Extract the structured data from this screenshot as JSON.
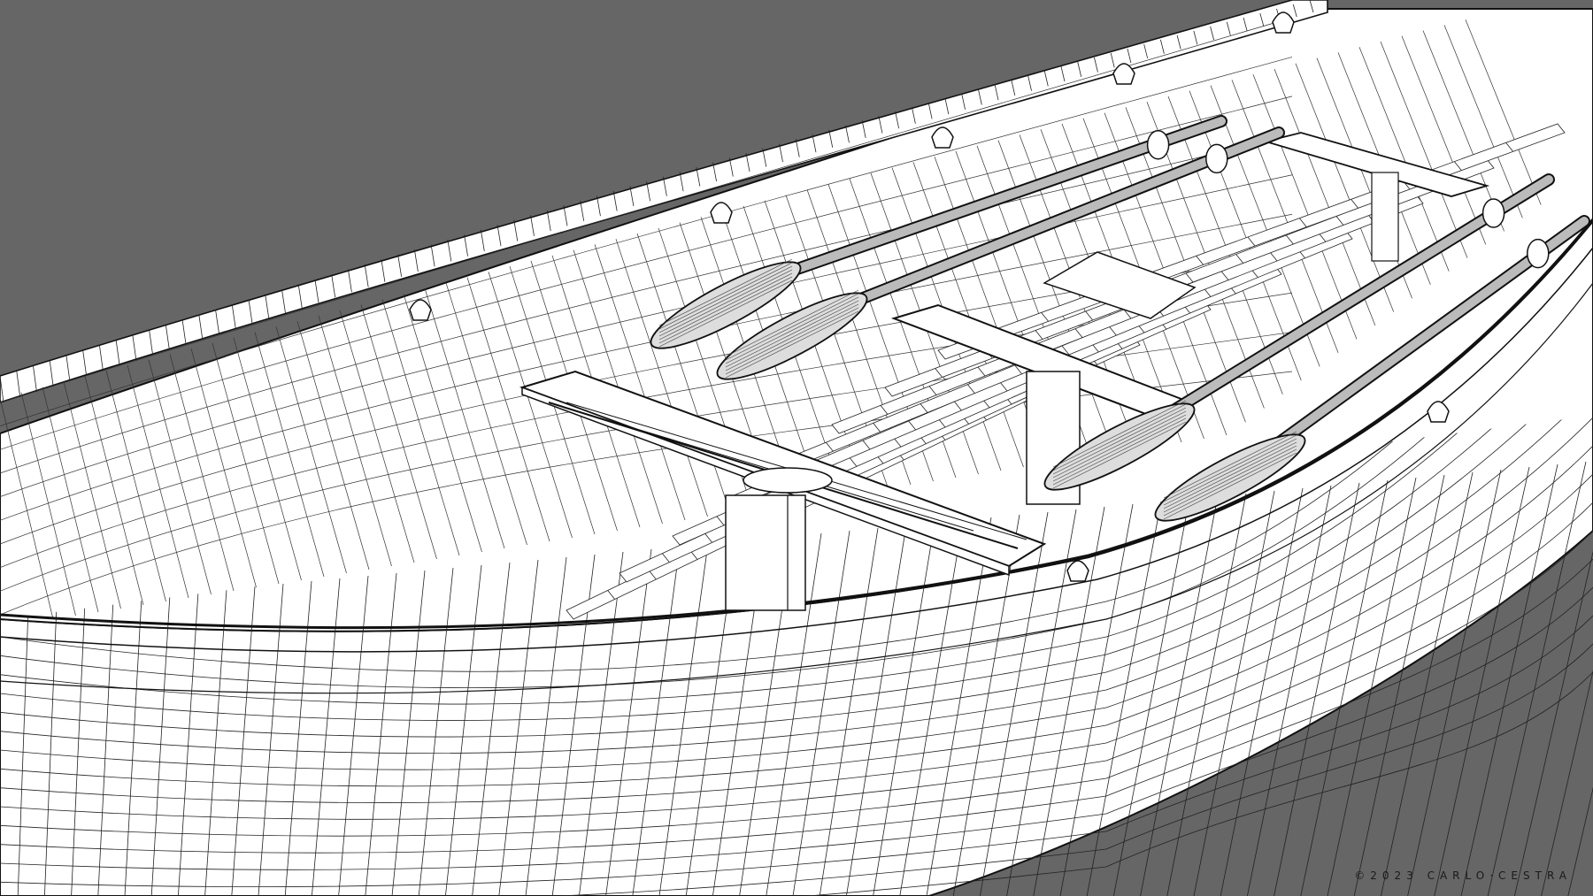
{
  "image": {
    "subject": "wireframe-rowboat",
    "background_color": "#666666",
    "surface_color": "#ffffff",
    "line_color": "#111111"
  },
  "watermark": {
    "text": "©2023 CARLO·CESTRA"
  }
}
